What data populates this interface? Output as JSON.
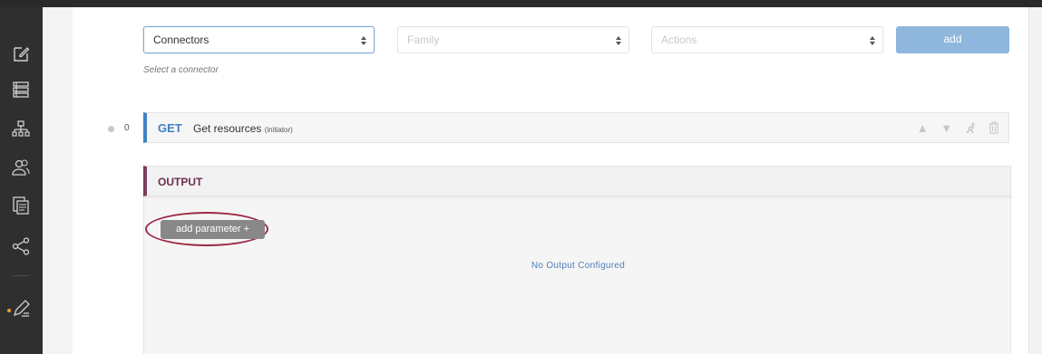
{
  "sidebar": {
    "icons": [
      "edit-icon",
      "list-icon",
      "org-chart-icon",
      "users-icon",
      "documents-icon",
      "share-icon",
      "pen-edit-icon"
    ]
  },
  "toolbar": {
    "connectors_select": {
      "value": "Connectors"
    },
    "family_select": {
      "placeholder": "Family"
    },
    "actions_select": {
      "placeholder": "Actions"
    },
    "add_label": "add",
    "hint": "Select a connector"
  },
  "step": {
    "index": "0",
    "method": "GET",
    "title": "Get resources",
    "subtitle": "(initiator)",
    "actions": [
      "move-up-icon",
      "move-down-icon",
      "run-icon",
      "trash-icon"
    ]
  },
  "output": {
    "title": "OUTPUT",
    "add_parameter_label": "add parameter +",
    "empty_message": "No Output Configured"
  },
  "colors": {
    "sidebar_bg": "#2f2f2f",
    "method_blue": "#3f82c4",
    "output_accent": "#7a3f5c",
    "highlight_ring": "#9c2a45",
    "add_button": "#8fb6dc"
  }
}
